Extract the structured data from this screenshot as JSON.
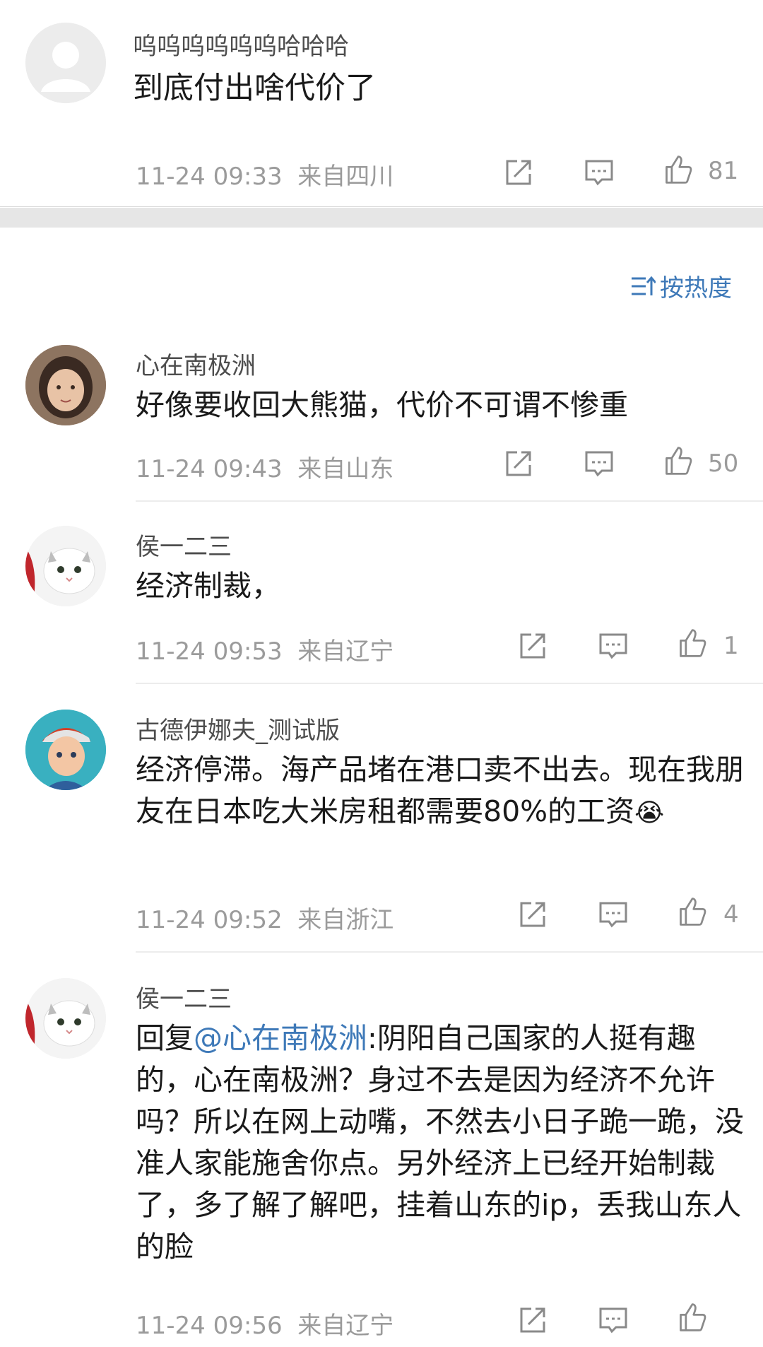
{
  "top_post": {
    "username": "呜呜呜呜呜呜哈哈哈",
    "text": "到底付出啥代价了",
    "time": "11-24 09:33",
    "location": "来自四川",
    "likes": "81"
  },
  "sort": {
    "label": "按热度"
  },
  "comments": [
    {
      "username": "心在南极洲",
      "text": "好像要收回大熊猫，代价不可谓不惨重",
      "time": "11-24 09:43",
      "location": "来自山东",
      "likes": "50"
    },
    {
      "username": "侯一二三",
      "text": "经济制裁，",
      "time": "11-24 09:53",
      "location": "来自辽宁",
      "likes": "1"
    },
    {
      "username": "古德伊娜夫_测试版",
      "text": "经济停滞。海产品堵在港口卖不出去。现在我朋友在日本吃大米房租都需要80%的工资",
      "emoji": "😭",
      "time": "11-24 09:52",
      "location": "来自浙江",
      "likes": "4"
    },
    {
      "username": "侯一二三",
      "reply_prefix": "回复",
      "mention": "@心在南极洲",
      "text": ":阴阳自己国家的人挺有趣的，心在南极洲？身过不去是因为经济不允许吗？所以在网上动嘴，不然去小日子跪一跪，没准人家能施舍你点。另外经济上已经开始制裁了，多了解了解吧，挂着山东的ip，丢我山东人的脸",
      "time": "11-24 09:56",
      "location": "来自辽宁"
    }
  ]
}
